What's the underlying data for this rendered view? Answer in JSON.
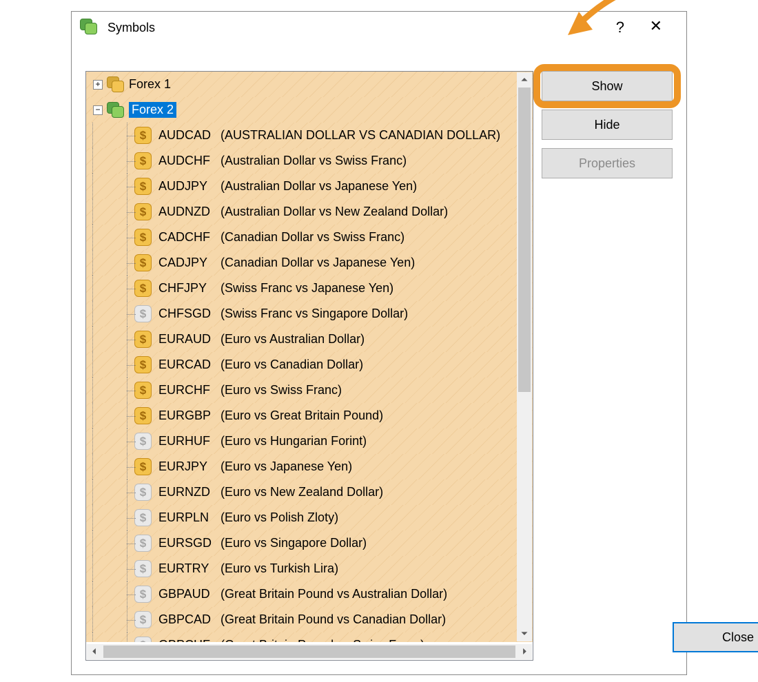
{
  "dialog": {
    "title": "Symbols",
    "help_glyph": "?",
    "close_glyph": "✕"
  },
  "buttons": {
    "show": "Show",
    "hide": "Hide",
    "properties": "Properties",
    "close": "Close"
  },
  "tree": {
    "groups": [
      {
        "id": "forex1",
        "label": "Forex 1",
        "expanded": false,
        "selected": false
      },
      {
        "id": "forex2",
        "label": "Forex 2",
        "expanded": true,
        "selected": true
      }
    ],
    "forex2_items": [
      {
        "code": "AUDCAD",
        "desc": "(AUSTRALIAN DOLLAR VS CANADIAN DOLLAR)",
        "shown": true
      },
      {
        "code": "AUDCHF",
        "desc": "(Australian Dollar vs Swiss Franc)",
        "shown": true
      },
      {
        "code": "AUDJPY",
        "desc": "(Australian Dollar vs Japanese Yen)",
        "shown": true
      },
      {
        "code": "AUDNZD",
        "desc": "(Australian Dollar vs New Zealand Dollar)",
        "shown": true
      },
      {
        "code": "CADCHF",
        "desc": "(Canadian Dollar vs Swiss Franc)",
        "shown": true
      },
      {
        "code": "CADJPY",
        "desc": "(Canadian Dollar vs Japanese Yen)",
        "shown": true
      },
      {
        "code": "CHFJPY",
        "desc": "(Swiss Franc vs Japanese Yen)",
        "shown": true
      },
      {
        "code": "CHFSGD",
        "desc": "(Swiss Franc vs Singapore Dollar)",
        "shown": false
      },
      {
        "code": "EURAUD",
        "desc": "(Euro vs Australian Dollar)",
        "shown": true
      },
      {
        "code": "EURCAD",
        "desc": "(Euro vs Canadian Dollar)",
        "shown": true
      },
      {
        "code": "EURCHF",
        "desc": "(Euro vs Swiss Franc)",
        "shown": true
      },
      {
        "code": "EURGBP",
        "desc": "(Euro vs Great Britain Pound)",
        "shown": true
      },
      {
        "code": "EURHUF",
        "desc": "(Euro vs Hungarian Forint)",
        "shown": false
      },
      {
        "code": "EURJPY",
        "desc": "(Euro vs Japanese Yen)",
        "shown": true
      },
      {
        "code": "EURNZD",
        "desc": "(Euro vs New Zealand Dollar)",
        "shown": false
      },
      {
        "code": "EURPLN",
        "desc": "(Euro vs Polish Zloty)",
        "shown": false
      },
      {
        "code": "EURSGD",
        "desc": "(Euro vs Singapore Dollar)",
        "shown": false
      },
      {
        "code": "EURTRY",
        "desc": "(Euro vs Turkish Lira)",
        "shown": false
      },
      {
        "code": "GBPAUD",
        "desc": "(Great Britain Pound vs Australian Dollar)",
        "shown": false
      },
      {
        "code": "GBPCAD",
        "desc": "(Great Britain Pound vs Canadian Dollar)",
        "shown": false
      },
      {
        "code": "GBPCHF",
        "desc": "(Great Britain Pound vs Swiss Franc)",
        "shown": false
      }
    ]
  },
  "colors": {
    "highlight": "#ed9526",
    "select": "#0078d7"
  }
}
